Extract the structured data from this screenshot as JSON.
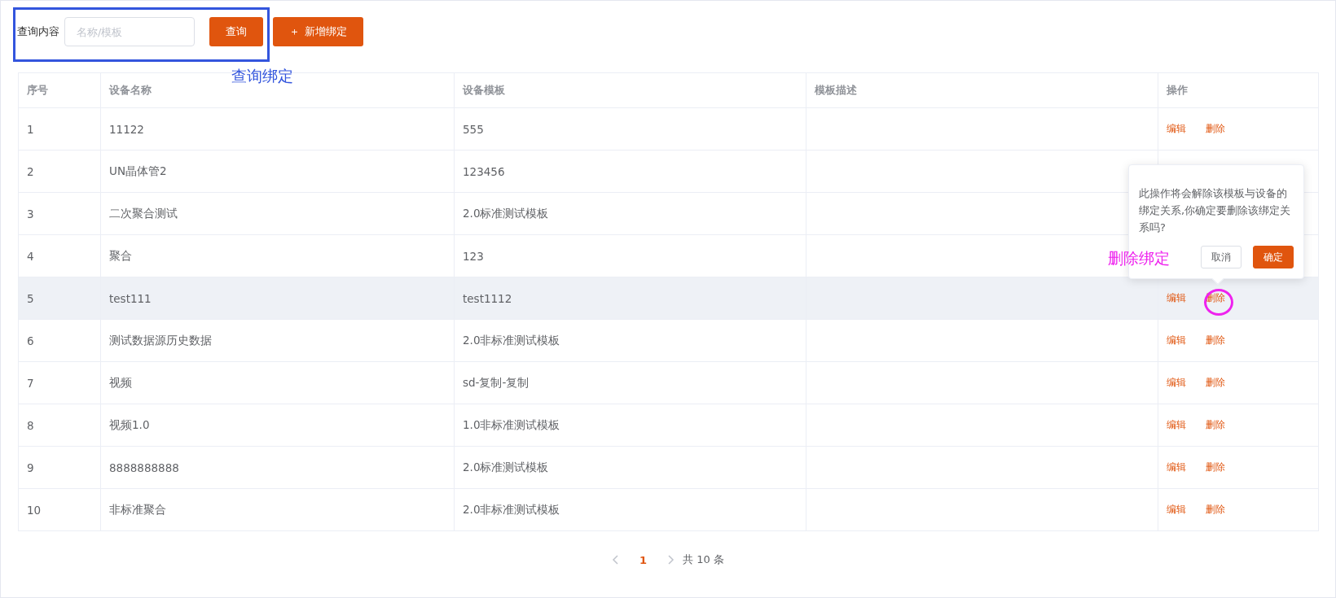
{
  "search": {
    "label": "查询内容",
    "placeholder": "名称/模板",
    "query_button": "查询",
    "add_button": {
      "icon": "＋",
      "label": "新增绑定"
    }
  },
  "table": {
    "columns": [
      "序号",
      "设备名称",
      "设备模板",
      "模板描述",
      "操作"
    ],
    "rows": [
      {
        "index": "1",
        "name": "11122",
        "template": "555",
        "hovered": false,
        "actions": [
          "编辑",
          "删除"
        ]
      },
      {
        "index": "2",
        "name": "UN晶体管2",
        "template": "123456",
        "hovered": false
      },
      {
        "index": "3",
        "name": "二次聚合测试",
        "template": "2.0标准测试模板",
        "hovered": false
      },
      {
        "index": "4",
        "name": "聚合",
        "template": "123",
        "hovered": false
      },
      {
        "index": "5",
        "name": "test111",
        "template": "test1112",
        "hovered": true,
        "actions": [
          "编辑",
          "删除"
        ]
      },
      {
        "index": "6",
        "name": "测试数据源历史数据",
        "template": "2.0非标准测试模板",
        "hovered": false,
        "actions": [
          "编辑",
          "删除"
        ]
      },
      {
        "index": "7",
        "name": "视频",
        "template": "sd-复制-复制",
        "hovered": false,
        "actions": [
          "编辑",
          "删除"
        ]
      },
      {
        "index": "8",
        "name": "视频1.0",
        "template": "1.0非标准测试模板",
        "hovered": false,
        "actions": [
          "编辑",
          "删除"
        ]
      },
      {
        "index": "9",
        "name": "8888888888",
        "template": "2.0标准测试模板",
        "hovered": false,
        "actions": [
          "编辑",
          "删除"
        ]
      },
      {
        "index": "10",
        "name": "非标准聚合",
        "template": "2.0非标准测试模板",
        "hovered": false,
        "actions": [
          "编辑",
          "删除"
        ]
      }
    ]
  },
  "popconfirm": {
    "message": "此操作将会解除该模板与设备的绑定关系,你确定要删除该绑定关系吗?",
    "cancel": "取消",
    "confirm": "确定"
  },
  "pagination": {
    "pages": [
      {
        "label": "1",
        "selected": true
      }
    ],
    "total": "共 10 条"
  },
  "annotations": [
    {
      "text": "查询绑定",
      "color": "#3355dd"
    },
    {
      "text": "删除绑定",
      "color": "#ee22ee"
    }
  ]
}
